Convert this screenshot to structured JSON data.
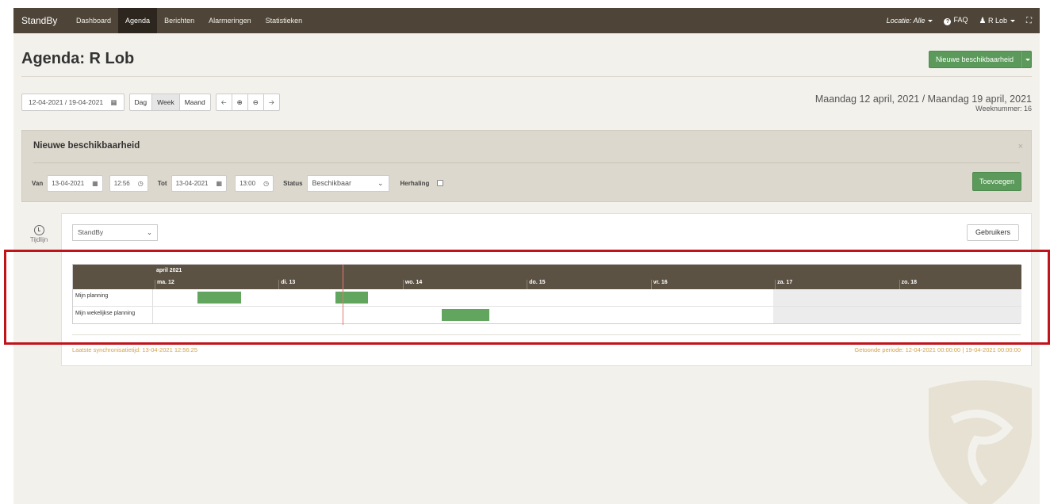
{
  "navbar": {
    "brand": "StandBy",
    "items": [
      "Dashboard",
      "Agenda",
      "Berichten",
      "Alarmeringen",
      "Statistieken"
    ],
    "active_index": 1,
    "location": "Locatie: Alle",
    "faq": "FAQ",
    "user": "R Lob"
  },
  "header": {
    "title": "Agenda: R Lob",
    "new_button": "Nieuwe beschikbaarheid"
  },
  "toolbar": {
    "date_range": "12-04-2021 / 19-04-2021",
    "views": [
      "Dag",
      "Week",
      "Maand"
    ],
    "active_view": "Week",
    "period_text": "Maandag 12 april, 2021 / Maandag 19 april, 2021",
    "week_number": "Weeknummer: 16"
  },
  "panel": {
    "title": "Nieuwe beschikbaarheid",
    "close": "×",
    "van_label": "Van",
    "van_date": "13-04-2021",
    "van_time": "12:56",
    "tot_label": "Tot",
    "tot_date": "13-04-2021",
    "tot_time": "13:00",
    "status_label": "Status",
    "status_value": "Beschikbaar",
    "herhaling_label": "Herhaling",
    "herhaling_checked": false,
    "add_button": "Toevoegen"
  },
  "timeline": {
    "icon_label": "Tijdlijn",
    "group_select": "StandBy",
    "users_button": "Gebruikers",
    "month": "april 2021",
    "days": [
      "ma. 12",
      "di. 13",
      "wo. 14",
      "do. 15",
      "vr. 16",
      "za. 17",
      "zo. 18"
    ],
    "weekend_from_day": 5,
    "now_day_fraction": 1.53,
    "lanes": [
      {
        "label": "Mijn planning",
        "bars": [
          {
            "start": 0.36,
            "end": 0.71
          },
          {
            "start": 1.47,
            "end": 1.73
          }
        ]
      },
      {
        "label": "Mijn wekelijkse planning",
        "bars": [
          {
            "start": 2.33,
            "end": 2.71
          }
        ]
      }
    ],
    "sync_text": "Laatste synchronisatietijd:  13-04-2021 12:56:25",
    "shown_period": "Getoonde periode: 12-04-2021 00:00:00  |  19-04-2021 00:00:00"
  },
  "colors": {
    "navbar": "#4e4538",
    "accent_green": "#5b9a5a",
    "highlight": "#c0131a"
  }
}
